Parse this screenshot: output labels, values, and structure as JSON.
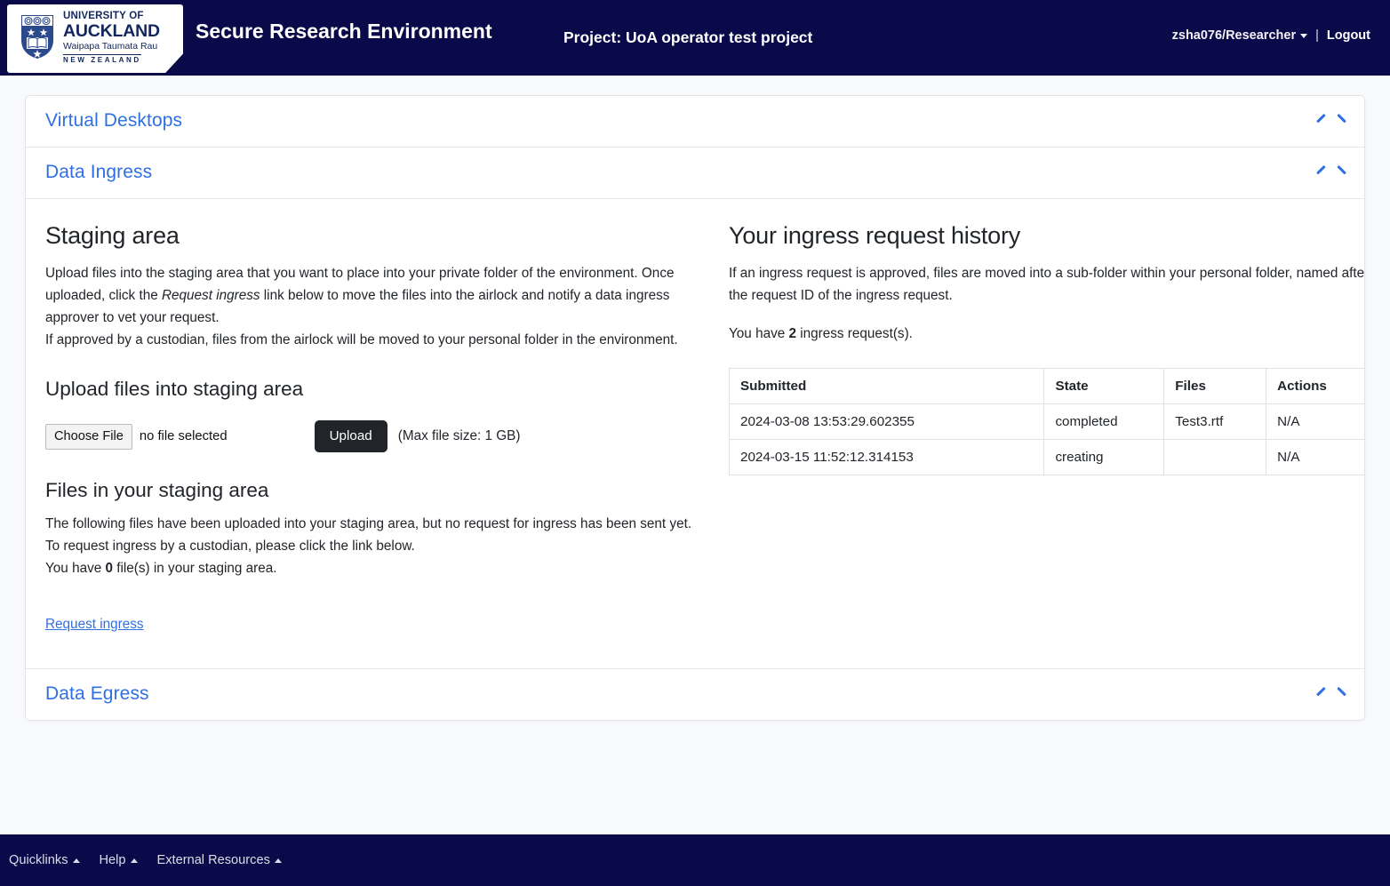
{
  "header": {
    "logo": {
      "line1": "UNIVERSITY OF",
      "line2": "AUCKLAND",
      "line3": "Waipapa Taumata Rau",
      "line4": "NEW ZEALAND",
      "crest_icon": "university-crest-icon"
    },
    "brand_title": "Secure Research Environment",
    "project_title": "Project: UoA operator test project",
    "user_label": "zsha076/Researcher",
    "separator": "|",
    "logout_label": "Logout",
    "navy": "#0a0a4a"
  },
  "accordions": [
    {
      "label": "Virtual Desktops",
      "expanded": true
    },
    {
      "label": "Data Ingress",
      "expanded": true
    },
    {
      "label": "Data Egress",
      "expanded": true
    }
  ],
  "staging": {
    "heading": "Staging area",
    "intro_part1": "Upload files into the staging area that you want to place into your private folder of the environment. Once uploaded, click the ",
    "intro_italic": "Request ingress",
    "intro_part2": " link below to move the files into the airlock and notify a data ingress approver to vet your request.",
    "intro_line2": "If approved by a custodian, files from the airlock will be moved to your personal folder in the environment.",
    "upload_heading": "Upload files into staging area",
    "choose_file_label": "Choose File",
    "file_name": "no file selected",
    "upload_button": "Upload",
    "max_size_note": "(Max file size: 1 GB)",
    "files_heading": "Files in your staging area",
    "files_text1": "The following files have been uploaded into your staging area, but no request for ingress has been sent yet.",
    "files_text2": "To request ingress by a custodian, please click the link below.",
    "files_count_prefix": "You have ",
    "files_count": "0",
    "files_count_suffix": " file(s) in your staging area.",
    "request_ingress_link": "Request ingress"
  },
  "history": {
    "heading": "Your ingress request history",
    "intro": "If an ingress request is approved, files are moved into a sub-folder within your personal folder, named after the request ID of the ingress request.",
    "count_prefix": "You have ",
    "count": "2",
    "count_suffix": " ingress request(s).",
    "columns": [
      "Submitted",
      "State",
      "Files",
      "Actions"
    ],
    "rows": [
      {
        "submitted": "2024-03-08 13:53:29.602355",
        "state": "completed",
        "files": "Test3.rtf",
        "actions": "N/A"
      },
      {
        "submitted": "2024-03-15 11:52:12.314153",
        "state": "creating",
        "files": "",
        "actions": "N/A"
      }
    ]
  },
  "footer": {
    "items": [
      {
        "label": "Quicklinks"
      },
      {
        "label": "Help"
      },
      {
        "label": "External Resources"
      }
    ]
  },
  "colors": {
    "link_blue": "#2f6fe4",
    "navy": "#0a0a4a",
    "dark_button": "#212529",
    "page_bg": "#f8f9fb"
  }
}
